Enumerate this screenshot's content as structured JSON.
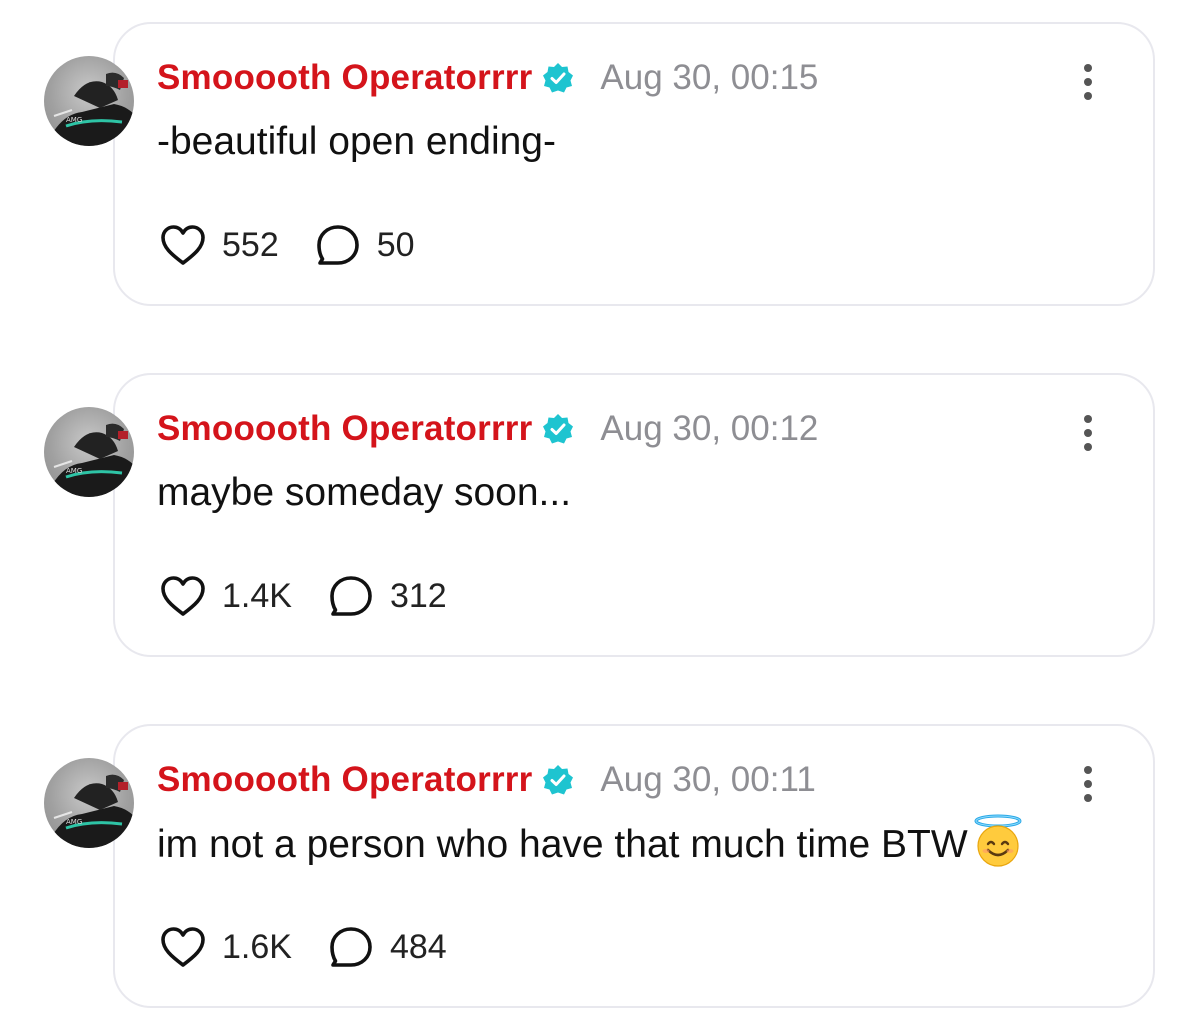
{
  "colors": {
    "username": "#d4141b",
    "timestamp": "#8e8e93",
    "verified_badge": "#1ec4d0",
    "card_border": "#e8e8ee"
  },
  "icons": {
    "verified": "verified-badge-icon",
    "like": "heart-icon",
    "reply": "speech-bubble-icon",
    "more": "more-vertical-icon"
  },
  "posts": [
    {
      "username": "Smooooth Operatorrrr",
      "timestamp": "Aug 30, 00:15",
      "text": "-beautiful open ending-",
      "likes": "552",
      "replies": "50"
    },
    {
      "username": "Smooooth Operatorrrr",
      "timestamp": "Aug 30, 00:12",
      "text": "maybe someday soon...",
      "likes": "1.4K",
      "replies": "312"
    },
    {
      "username": "Smooooth Operatorrrr",
      "timestamp": "Aug 30, 00:11",
      "text": "im not a person who have that much time BTW",
      "emoji": "smiling-face-with-halo",
      "likes": "1.6K",
      "replies": "484"
    }
  ]
}
